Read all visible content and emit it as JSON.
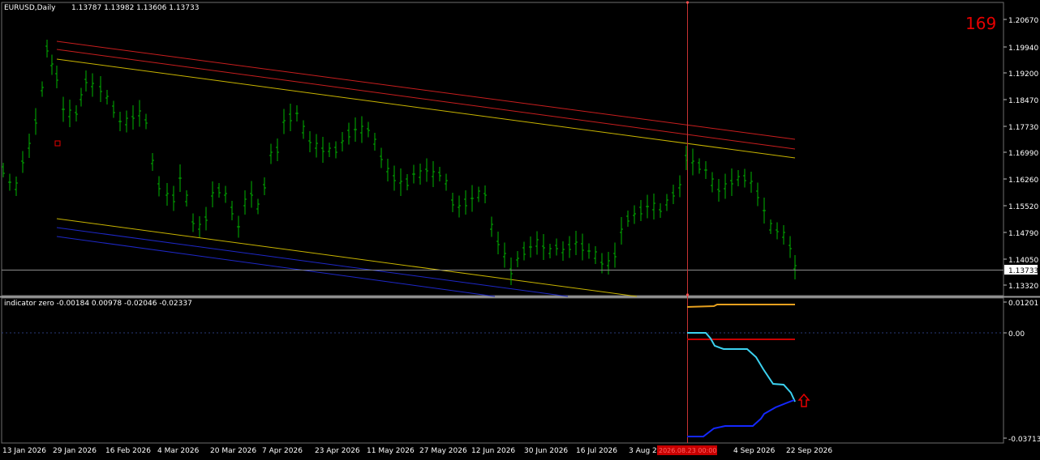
{
  "main_pane": {
    "title": "EURUSD,Daily",
    "ohlc": "1.13787 1.13982 1.13606 1.13733",
    "counter": "169",
    "current_price": "1.13733",
    "price_ticks": [
      "1.20670",
      "1.19940",
      "1.19200",
      "1.18470",
      "1.17730",
      "1.16990",
      "1.16260",
      "1.15520",
      "1.14790",
      "1.14050",
      "1.13320"
    ]
  },
  "indicator_pane": {
    "title": "indicator zero -0.00184 0.00978 -0.02046 -0.02337",
    "value_ticks": [
      "0.01201",
      "0.00",
      "-0.03713"
    ]
  },
  "time_axis": {
    "labels": [
      "13 Jan 2026",
      "29 Jan 2026",
      "16 Feb 2026",
      "4 Mar 2026",
      "20 Mar 2026",
      "7 Apr 2026",
      "23 Apr 2026",
      "11 May 2026",
      "27 May 2026",
      "12 Jun 2026",
      "30 Jun 2026",
      "16 Jul 2026",
      "3 Aug 20",
      "4 Sep 2026",
      "22 Sep 2026"
    ],
    "cursor_label": "2026.08.23 00:00"
  },
  "colors": {
    "background": "#000000",
    "bars": "#00b400",
    "channel_red": "#c81e1e",
    "channel_yellow": "#c8b400",
    "channel_blue": "#1e28c8",
    "cyan_line": "#3cd2f0",
    "blue_line": "#1428ff",
    "orange_line": "#e6a01e",
    "red_line": "#c80000",
    "counter": "#e60000",
    "cursor": "#c83232"
  },
  "chart_data": {
    "type": "ohlc",
    "timeframe": "Daily",
    "symbol": "EURUSD",
    "last_ohlc": {
      "open": 1.13787,
      "high": 1.13982,
      "low": 1.13606,
      "close": 1.13733
    },
    "counter": 169,
    "indicator_values": [
      -0.00184,
      0.00978,
      -0.02046,
      -0.02337
    ],
    "y_price_range": [
      1.1332,
      1.2067
    ]
  }
}
